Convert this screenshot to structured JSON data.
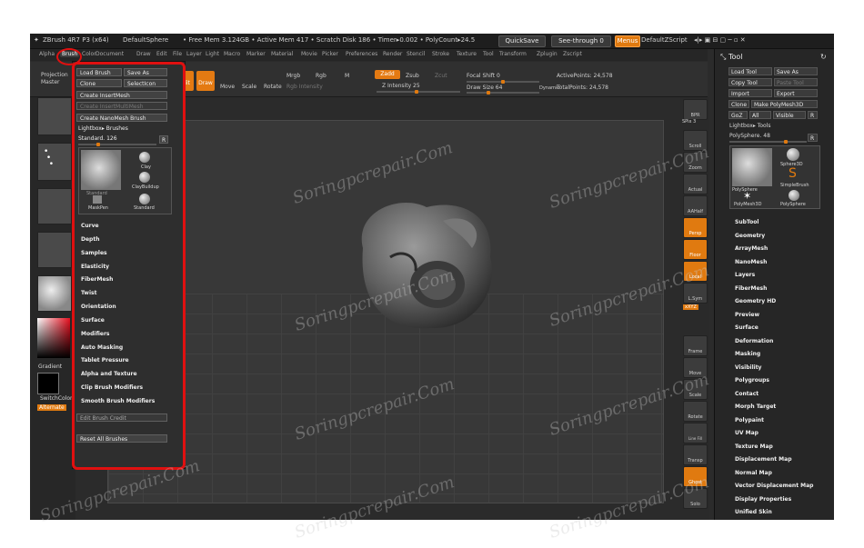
{
  "titlebar": {
    "app": "ZBrush 4R7 P3 (x64)",
    "doc": "DefaultSphere",
    "status": "• Free Mem 3.124GB • Active Mem 417 • Scratch Disk 186 • Timer▸0.002 • PolyCount▸24.5",
    "quicksave": "QuickSave",
    "seethrough": "See-through  0",
    "menus": "Menus",
    "script": "DefaultZScript"
  },
  "menubar": [
    "Alpha",
    "Brush",
    "Color",
    "Document",
    "Draw",
    "Edit",
    "File",
    "Layer",
    "Light",
    "Macro",
    "Marker",
    "Material",
    "Movie",
    "Picker",
    "Preferences",
    "Render",
    "Stencil",
    "Stroke",
    "Texture",
    "Tool",
    "Transform",
    "Zplugin",
    "Zscript"
  ],
  "toolbar": {
    "projection": "Projection Master",
    "edit": "Edit",
    "draw": "Draw",
    "move": "Move",
    "scale": "Scale",
    "rotate": "Rotate",
    "mrgb": "Mrgb",
    "rgb": "Rgb",
    "m": "M",
    "rgb_intensity": "Rgb Intensity",
    "zadd": "Zadd",
    "zsub": "Zsub",
    "zcut": "Zcut",
    "z_intensity": "Z Intensity 25",
    "focal_shift": "Focal Shift 0",
    "draw_size": "Draw Size 64",
    "dynamic": "Dynamic",
    "active_points": "ActivePoints: 24,578",
    "total_points": "TotalPoints: 24,578"
  },
  "left_shelf": {
    "gradient": "Gradient",
    "switchcolor": "SwitchColor",
    "alternate": "Alternate"
  },
  "brush_menu": {
    "top_buttons": [
      "Load Brush",
      "Save As",
      "Clone",
      "SelectIcon"
    ],
    "create_insertmesh": "Create InsertMesh",
    "create_insertmultimesh": "Create InsertMultiMesh",
    "create_nanomesh": "Create NanoMesh Brush",
    "lightbox_brushes": "Lightbox▸ Brushes",
    "current": "Standard. 126",
    "r": "R",
    "thumbs": [
      "Standard",
      "Clay",
      "ClayBuildup",
      "MaskPen",
      "Standard"
    ],
    "items": [
      "Curve",
      "Depth",
      "Samples",
      "Elasticity",
      "FiberMesh",
      "Twist",
      "Orientation",
      "Surface",
      "Modifiers",
      "Auto Masking",
      "Tablet Pressure",
      "Alpha and Texture",
      "Clip Brush Modifiers",
      "Smooth Brush Modifiers"
    ],
    "edit_credit": "Edit Brush Credit",
    "reset": "Reset All Brushes"
  },
  "right_shelf": [
    "BPR",
    "SPix 3",
    "Scroll",
    "Zoom",
    "Actual",
    "AAHalf",
    "Persp",
    "Floor",
    "Local",
    "L.Sym",
    "xXYZ",
    "Frame",
    "Move",
    "Scale",
    "Rotate",
    "Line Fill PolyF",
    "Transp",
    "Ghost",
    "Solo"
  ],
  "tool_panel": {
    "title": "Tool",
    "buttons": [
      "Load Tool",
      "Save As",
      "Copy Tool",
      "Paste Tool",
      "Import",
      "Export",
      "Clone",
      "Make PolyMesh3D",
      "GoZ",
      "All",
      "Visible",
      "R"
    ],
    "lightbox_tools": "Lightbox▸ Tools",
    "current": "PolySphere. 48",
    "r": "R",
    "thumbs": [
      "PolySphere",
      "Sphere3D",
      "SimpleBrush",
      "PolyMesh3D",
      "PolySphere"
    ],
    "items": [
      "SubTool",
      "Geometry",
      "ArrayMesh",
      "NanoMesh",
      "Layers",
      "FiberMesh",
      "Geometry HD",
      "Preview",
      "Surface",
      "Deformation",
      "Masking",
      "Visibility",
      "Polygroups",
      "Contact",
      "Morph Target",
      "Polypaint",
      "UV Map",
      "Texture Map",
      "Displacement Map",
      "Normal Map",
      "Vector Displacement Map",
      "Display Properties",
      "Unified Skin"
    ]
  },
  "watermark": "Soringpcrepair.Com",
  "colors": {
    "accent": "#e07a10",
    "highlight": "#e01010"
  }
}
